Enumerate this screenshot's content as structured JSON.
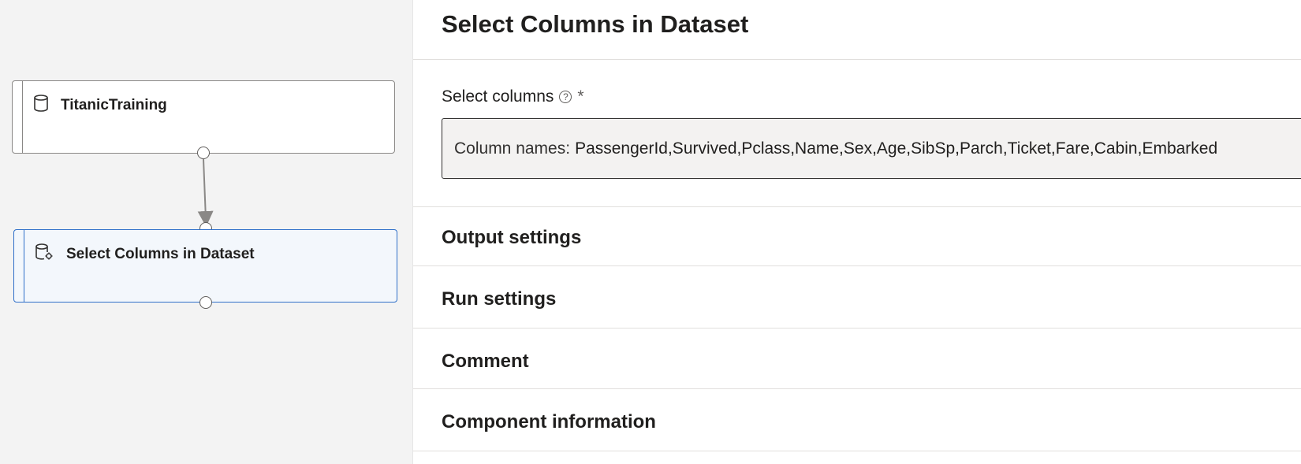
{
  "canvas": {
    "nodes": [
      {
        "label": "TitanicTraining",
        "icon": "database-icon"
      },
      {
        "label": "Select Columns in Dataset",
        "icon": "database-settings-icon",
        "selected": true
      }
    ]
  },
  "panel": {
    "title": "Select Columns in Dataset",
    "select_columns": {
      "label": "Select columns",
      "help_icon": "help-icon",
      "required_marker": "*",
      "prefix": "Column names:",
      "value": "PassengerId,Survived,Pclass,Name,Sex,Age,SibSp,Parch,Ticket,Fare,Cabin,Embarked"
    },
    "sections": [
      {
        "label": "Output settings"
      },
      {
        "label": "Run settings"
      },
      {
        "label": "Comment"
      },
      {
        "label": "Component information"
      }
    ]
  },
  "colors": {
    "selected_border": "#2f6fc9",
    "canvas_background": "#f3f3f3"
  }
}
